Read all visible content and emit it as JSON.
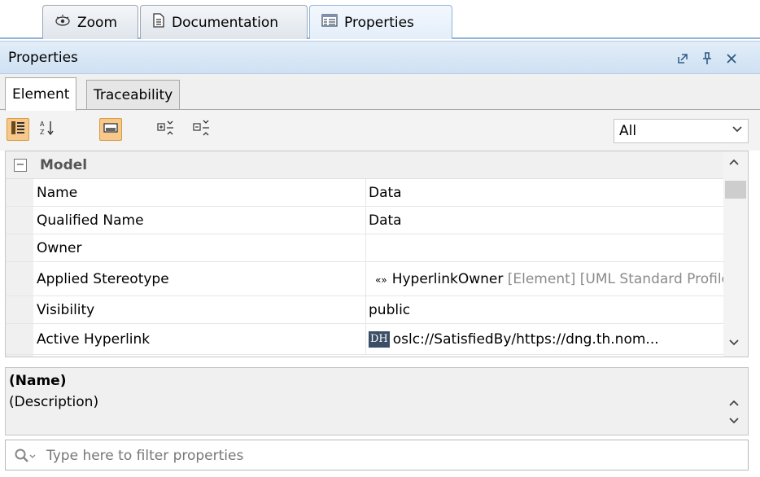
{
  "tabs": [
    {
      "label": "Zoom",
      "icon": "eye-icon"
    },
    {
      "label": "Documentation",
      "icon": "document-icon"
    },
    {
      "label": "Properties",
      "icon": "properties-icon",
      "active": true
    }
  ],
  "panel": {
    "title": "Properties",
    "controls": [
      "undock-icon",
      "pin-icon",
      "close-icon"
    ]
  },
  "subtabs": [
    {
      "label": "Element",
      "active": true
    },
    {
      "label": "Traceability"
    }
  ],
  "toolbar": {
    "buttons": [
      "categorized-view-icon",
      "sort-alphabetical-icon",
      "description-toggle-icon",
      "expand-all-icon",
      "collapse-all-icon"
    ],
    "filter_select": {
      "value": "All"
    }
  },
  "grid": {
    "group": {
      "name": "Model",
      "expanded_symbol": "⊟"
    },
    "rows": [
      {
        "name": "Name",
        "value": "Data"
      },
      {
        "name": "Qualified Name",
        "value": "Data"
      },
      {
        "name": "Owner",
        "value": ""
      },
      {
        "name": "Applied Stereotype",
        "value_prefix": "«»",
        "value": "HyperlinkOwner",
        "value_suffix": "[Element] [UML Standard Profile::MagicDraw Profile]"
      },
      {
        "name": "Visibility",
        "value": "public"
      },
      {
        "name": "Active Hyperlink",
        "badge": "DH",
        "value": "oslc://SatisfiedBy/https://dng.th.nom..."
      }
    ]
  },
  "description": {
    "name": "(Name)",
    "text": "(Description)"
  },
  "filter": {
    "placeholder": "Type here to filter properties"
  },
  "colors": {
    "accent_blue": "#cfe1f3",
    "pressed_orange": "#f7c88b"
  }
}
